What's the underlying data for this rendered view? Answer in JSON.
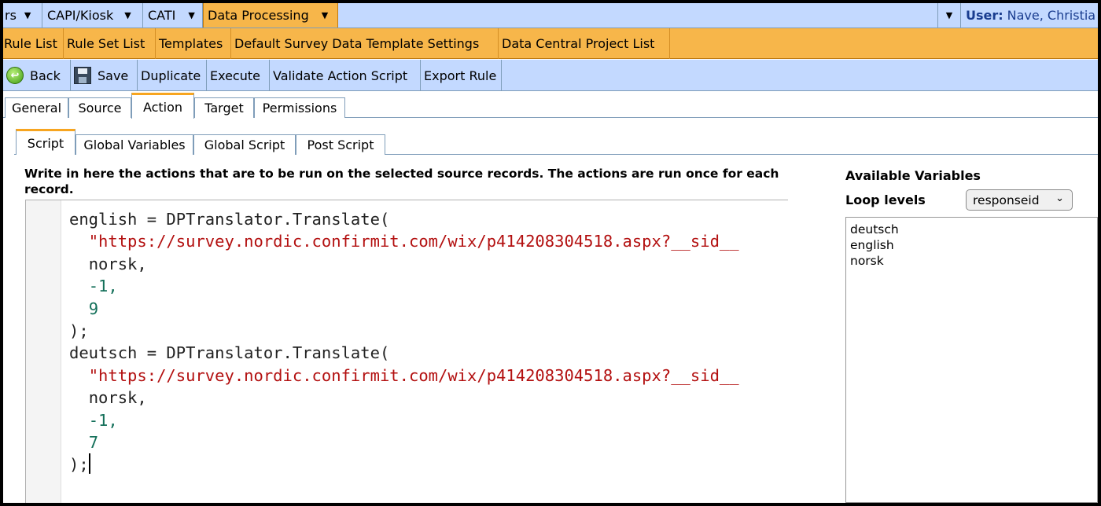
{
  "topbar": {
    "menus": [
      {
        "label": "rs"
      },
      {
        "label": "CAPI/Kiosk"
      },
      {
        "label": "CATI"
      },
      {
        "label": "Data Processing"
      }
    ],
    "user_label": "User:",
    "user_name": "Nave, Christia"
  },
  "subbar": {
    "items": [
      "Rule List",
      "Rule Set List",
      "Templates",
      "Default Survey Data Template Settings",
      "Data Central Project List"
    ]
  },
  "toolbar": {
    "back": "Back",
    "save": "Save",
    "duplicate": "Duplicate",
    "execute": "Execute",
    "validate": "Validate Action Script",
    "export": "Export Rule"
  },
  "tabs": [
    "General",
    "Source",
    "Action",
    "Target",
    "Permissions"
  ],
  "subtabs": [
    "Script",
    "Global Variables",
    "Global Script",
    "Post Script"
  ],
  "description": "Write in here the actions that are to be run on the selected source records. The actions are run once for each record.",
  "code": {
    "l1": "english = DPTranslator.Translate(",
    "l2": "\"https://survey.nordic.confirmit.com/wix/p414208304518.aspx?__sid__",
    "l3": "norsk,",
    "l4": "-1,",
    "l5": "9",
    "l6": ");",
    "l7": "deutsch = DPTranslator.Translate(",
    "l8": "\"https://survey.nordic.confirmit.com/wix/p414208304518.aspx?__sid__",
    "l9": "norsk,",
    "l10": "-1,",
    "l11": "7",
    "l12": ");"
  },
  "panel": {
    "title": "Available Variables",
    "loop_label": "Loop levels",
    "loop_value": "responseid",
    "variables": [
      "deutsch",
      "english",
      "norsk"
    ]
  },
  "colors": {
    "menu_blue": "#c3d9ff",
    "accent_orange": "#f7b64a",
    "string": "#b31010",
    "number": "#14705a"
  }
}
